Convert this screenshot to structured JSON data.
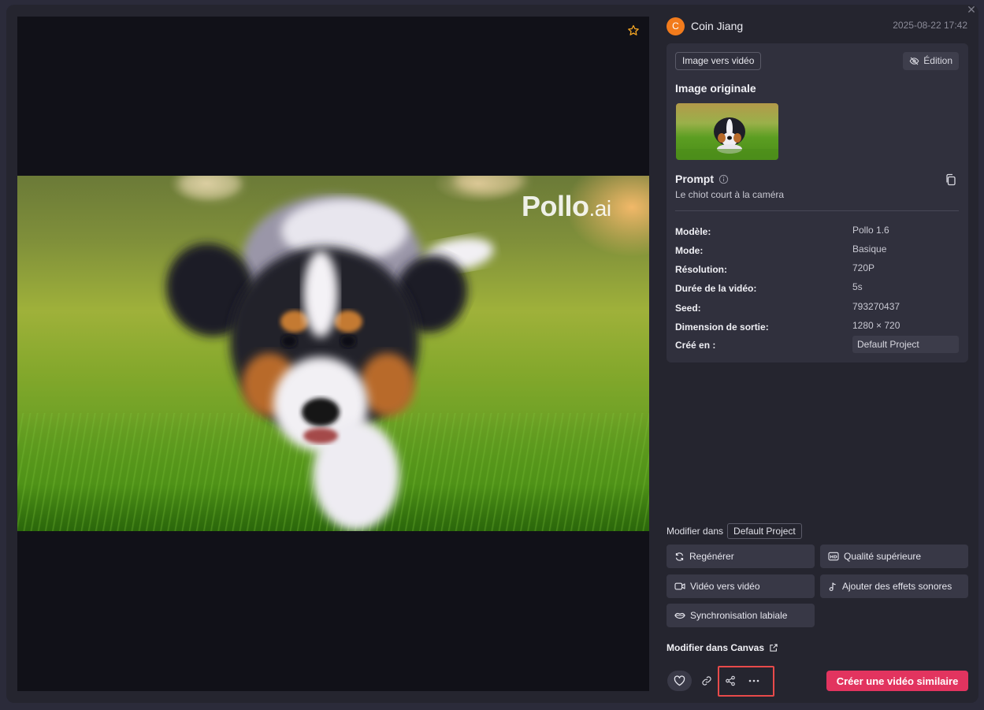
{
  "author": {
    "initial": "C",
    "name": "Coin Jiang",
    "timestamp": "2025-08-22 17:42"
  },
  "watermark": {
    "brand": "Pollo",
    "suffix": ".ai"
  },
  "card": {
    "mode_tag": "Image vers vidéo",
    "edit_label": "Édition",
    "original_image_title": "Image originale",
    "prompt_title": "Prompt",
    "prompt_text": "Le chiot court à la caméra",
    "meta": [
      {
        "label": "Modèle:",
        "value": "Pollo 1.6"
      },
      {
        "label": "Mode:",
        "value": "Basique"
      },
      {
        "label": "Résolution:",
        "value": "720P"
      },
      {
        "label": "Durée de la vidéo:",
        "value": "5s"
      },
      {
        "label": "Seed:",
        "value": "793270437"
      },
      {
        "label": "Dimension de sortie:",
        "value": "1280 × 720"
      },
      {
        "label": "Créé en :",
        "value": "Default Project"
      }
    ]
  },
  "modify": {
    "label": "Modifier dans",
    "project": "Default Project"
  },
  "actions": {
    "regenerate": "Regénérer",
    "upscale": "Qualité supérieure",
    "video_to_video": "Vidéo vers vidéo",
    "sound_effects": "Ajouter des effets sonores",
    "lip_sync": "Synchronisation labiale"
  },
  "canvas_link": "Modifier dans Canvas",
  "create_similar": "Créer une vidéo similaire",
  "colors": {
    "accent": "#e2345f",
    "avatar": "#f27b1c",
    "highlight": "#e84a4a",
    "star": "#f5a623"
  },
  "icons": [
    "close-icon",
    "star-icon",
    "hide-icon",
    "info-icon",
    "copy-icon",
    "refresh-icon",
    "hd-icon",
    "video-icon",
    "music-note-icon",
    "lips-icon",
    "external-link-icon",
    "heart-icon",
    "link-icon",
    "share-icon",
    "more-icon"
  ]
}
